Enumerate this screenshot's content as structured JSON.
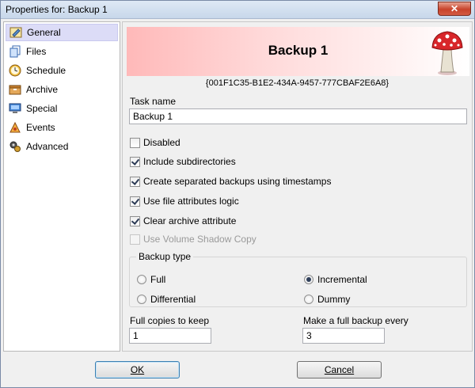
{
  "window": {
    "title": "Properties for: Backup 1",
    "close_label": "✕"
  },
  "nav": {
    "items": [
      {
        "label": "General",
        "icon": "general-icon",
        "active": true
      },
      {
        "label": "Files",
        "icon": "files-icon",
        "active": false
      },
      {
        "label": "Schedule",
        "icon": "schedule-icon",
        "active": false
      },
      {
        "label": "Archive",
        "icon": "archive-icon",
        "active": false
      },
      {
        "label": "Special",
        "icon": "special-icon",
        "active": false
      },
      {
        "label": "Events",
        "icon": "events-icon",
        "active": false
      },
      {
        "label": "Advanced",
        "icon": "advanced-icon",
        "active": false
      }
    ]
  },
  "banner": {
    "title": "Backup 1",
    "guid": "{001F1C35-B1E2-434A-9457-777CBAF2E6A8}",
    "icon": "mushroom-icon"
  },
  "task": {
    "label": "Task name",
    "value": "Backup 1"
  },
  "options": [
    {
      "label": "Disabled",
      "checked": false,
      "enabled": true
    },
    {
      "label": "Include subdirectories",
      "checked": true,
      "enabled": true
    },
    {
      "label": "Create separated backups using timestamps",
      "checked": true,
      "enabled": true
    },
    {
      "label": "Use file attributes logic",
      "checked": true,
      "enabled": true
    },
    {
      "label": "Clear archive attribute",
      "checked": true,
      "enabled": true
    },
    {
      "label": "Use Volume Shadow Copy",
      "checked": false,
      "enabled": false
    }
  ],
  "backup_type": {
    "label": "Backup type",
    "options": [
      {
        "label": "Full",
        "selected": false
      },
      {
        "label": "Incremental",
        "selected": true
      },
      {
        "label": "Differential",
        "selected": false
      },
      {
        "label": "Dummy",
        "selected": false
      }
    ]
  },
  "full_copies": {
    "label": "Full copies to keep",
    "value": "1"
  },
  "full_every": {
    "label": "Make a full backup every",
    "value": "3"
  },
  "buttons": {
    "ok_label": "OK",
    "cancel_label": "Cancel"
  },
  "colors": {
    "nav_active_bg": "#dcdcf7",
    "banner_start": "#ffb9b9",
    "banner_end": "#ffffff"
  }
}
